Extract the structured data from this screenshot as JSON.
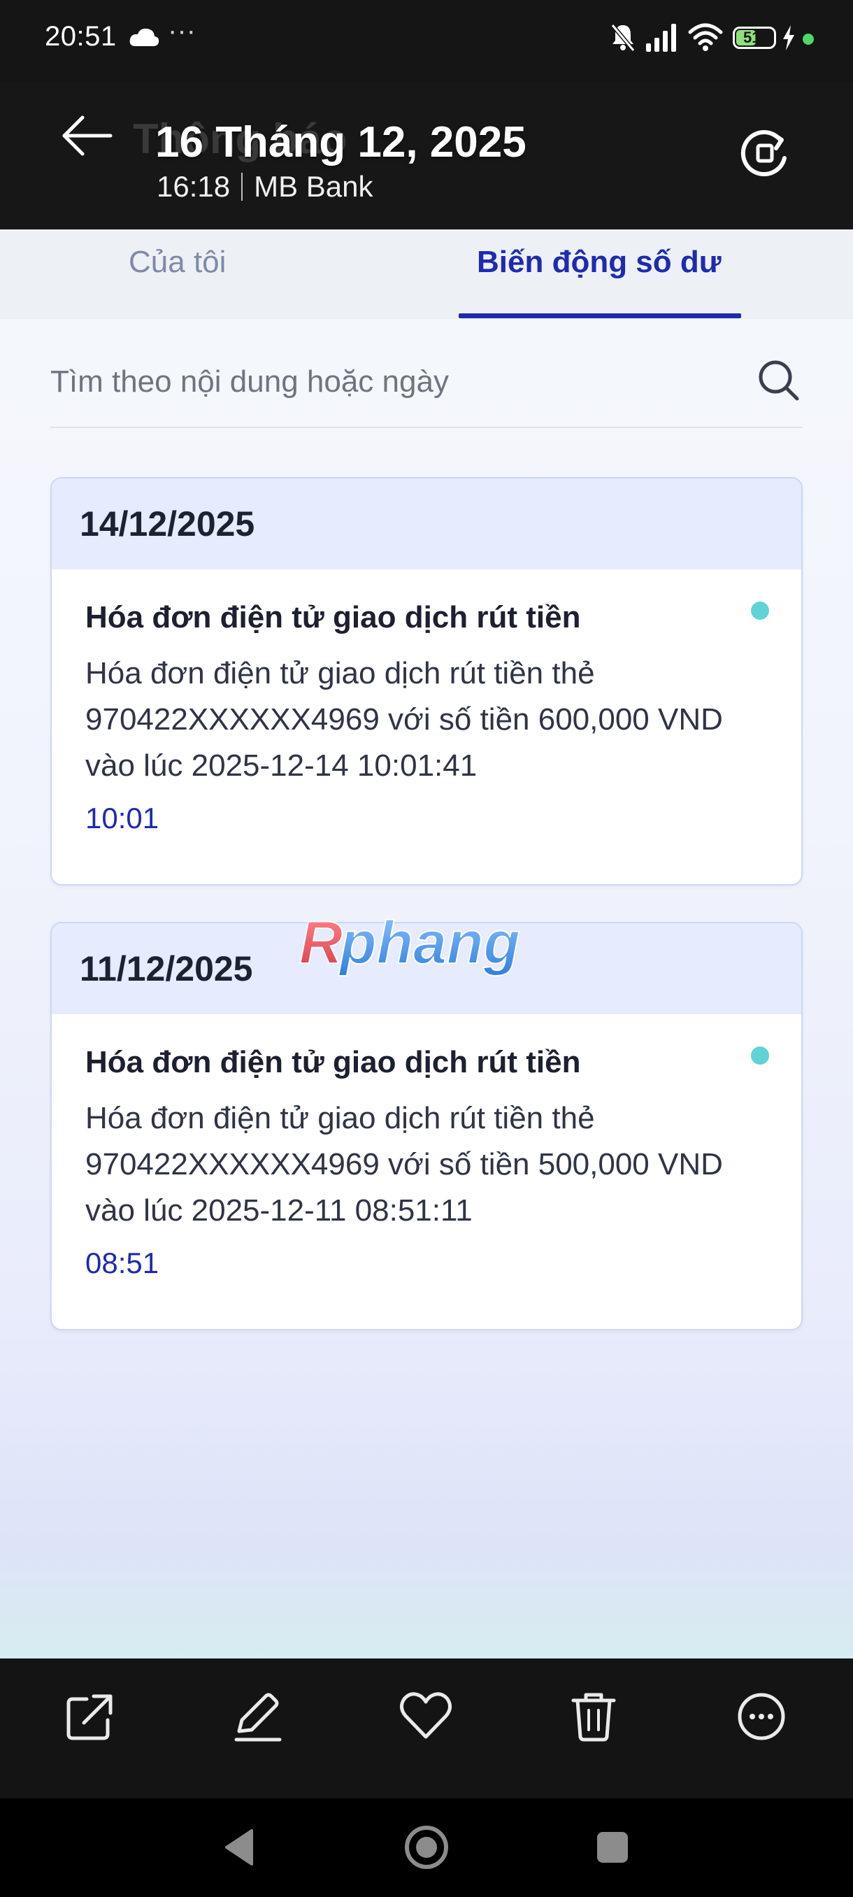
{
  "status_bar": {
    "time": "20:51",
    "dots": "···",
    "battery": "51"
  },
  "header": {
    "ghost_title": "Thông báo",
    "date": "16 Tháng 12, 2025",
    "time": "16:18",
    "source": "MB Bank"
  },
  "tabs": [
    {
      "label": "Của tôi",
      "active": false
    },
    {
      "label": "Biến động số dư",
      "active": true
    }
  ],
  "search": {
    "placeholder": "Tìm theo nội dung hoặc ngày"
  },
  "notifications": [
    {
      "date": "14/12/2025",
      "title": "Hóa đơn điện tử giao dịch rút tiền",
      "description": "Hóa đơn điện tử giao dịch rút tiền thẻ 970422XXXXXX4969 với số tiền 600,000 VND vào lúc 2025-12-14 10:01:41",
      "time": "10:01",
      "unread": true
    },
    {
      "date": "11/12/2025",
      "title": "Hóa đơn điện tử giao dịch rút tiền",
      "description": "Hóa đơn điện tử giao dịch rút tiền thẻ 970422XXXXXX4969 với số tiền 500,000 VND vào lúc 2025-12-11 08:51:11",
      "time": "08:51",
      "unread": true
    }
  ],
  "watermark": "Rphang",
  "toolbar": [
    "share-icon",
    "edit-icon",
    "heart-icon",
    "trash-icon",
    "more-icon"
  ],
  "navbar": [
    "back-icon",
    "home-icon",
    "recents-icon"
  ],
  "colors": {
    "accent": "#1e2bb0",
    "unread_dot": "#5fd3d6",
    "card_header": "#e6ebfd"
  }
}
